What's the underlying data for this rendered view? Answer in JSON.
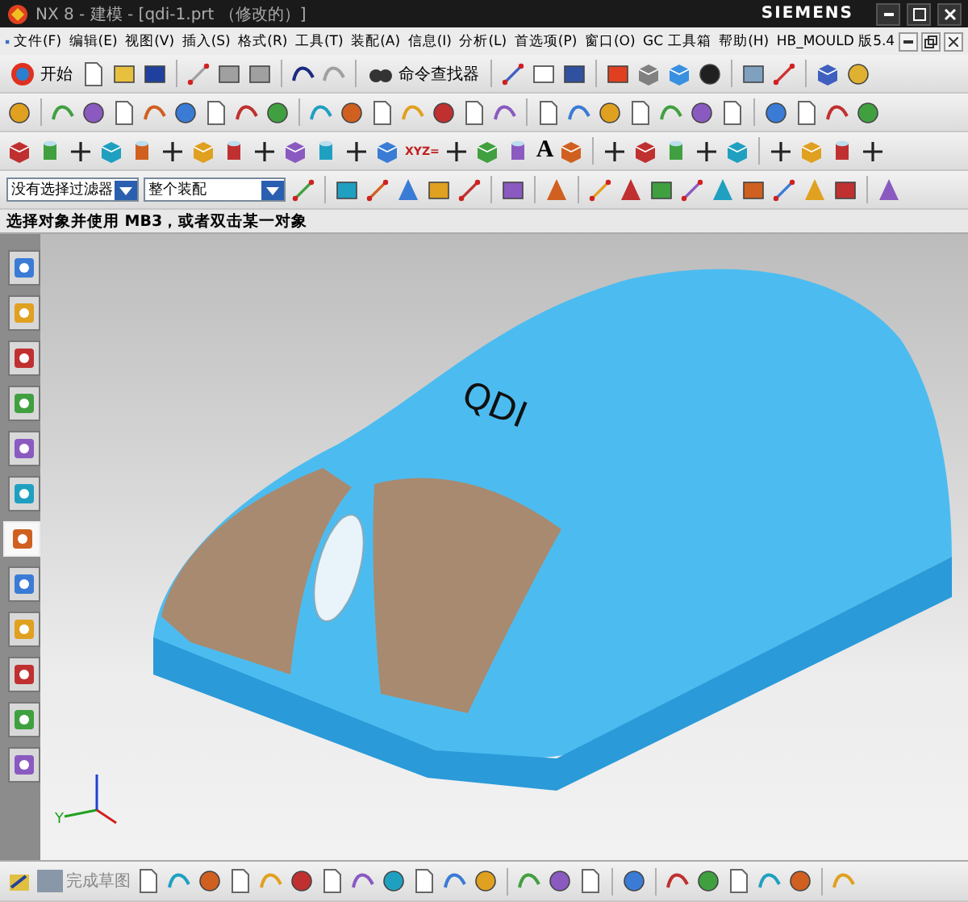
{
  "window": {
    "title": "NX 8 - 建模 - [qdi-1.prt （修改的）]",
    "brand": "SIEMENS"
  },
  "menu": [
    "文件(F)",
    "编辑(E)",
    "视图(V)",
    "插入(S)",
    "格式(R)",
    "工具(T)",
    "装配(A)",
    "信息(I)",
    "分析(L)",
    "首选项(P)",
    "窗口(O)",
    "GC 工具箱",
    "帮助(H)",
    "HB_MOULD 版5.4"
  ],
  "toolbar": {
    "start_label": "开始",
    "finder_label": "命令查找器",
    "glyphs": [
      "XYZ=",
      "A"
    ]
  },
  "filters": [
    {
      "value": "没有选择过滤器"
    },
    {
      "value": "整个装配"
    }
  ],
  "status": "选择对象并使用 MB3，或者双击某一对象",
  "resource_tabs": [
    {
      "selected": false
    },
    {
      "selected": false
    },
    {
      "selected": false
    },
    {
      "selected": false
    },
    {
      "selected": false
    },
    {
      "selected": false
    },
    {
      "selected": true
    },
    {
      "selected": false
    },
    {
      "selected": false
    },
    {
      "selected": false
    },
    {
      "selected": false
    },
    {
      "selected": false
    }
  ],
  "model": {
    "label": "QDI",
    "triad_label": "Y"
  },
  "sketch_toolbar": {
    "finish_label": "完成草图"
  }
}
